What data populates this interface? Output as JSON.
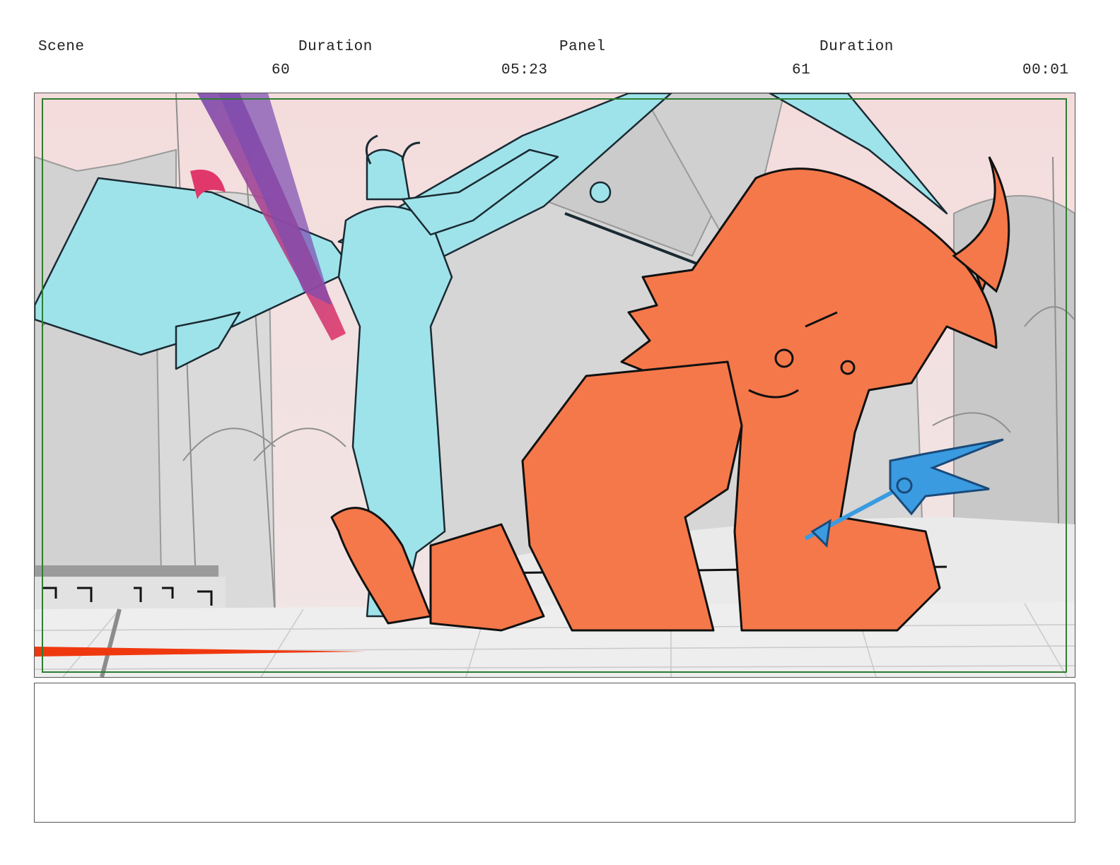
{
  "header": {
    "scene_label": "Scene",
    "scene_duration_label": "Duration",
    "panel_label": "Panel",
    "panel_duration_label": "Duration",
    "scene_number": "60",
    "scene_duration": "05:23",
    "panel_number": "61",
    "panel_duration": "00:01"
  },
  "panel_image": {
    "subject": "storyboard-sketch",
    "colors": {
      "sky": "#f3dede",
      "architecture": "#cfcfcf",
      "floor": "#efefef",
      "demon_cyan": "#9fe3ea",
      "demon_orange": "#f5784a",
      "trident_blue": "#3a9be0",
      "slash_magenta": "#e0386a",
      "slash_purple": "#7a4bb0",
      "speed_line_red": "#f0380f",
      "safe_frame_green": "#2e7d32"
    }
  },
  "notes": {
    "text": ""
  }
}
